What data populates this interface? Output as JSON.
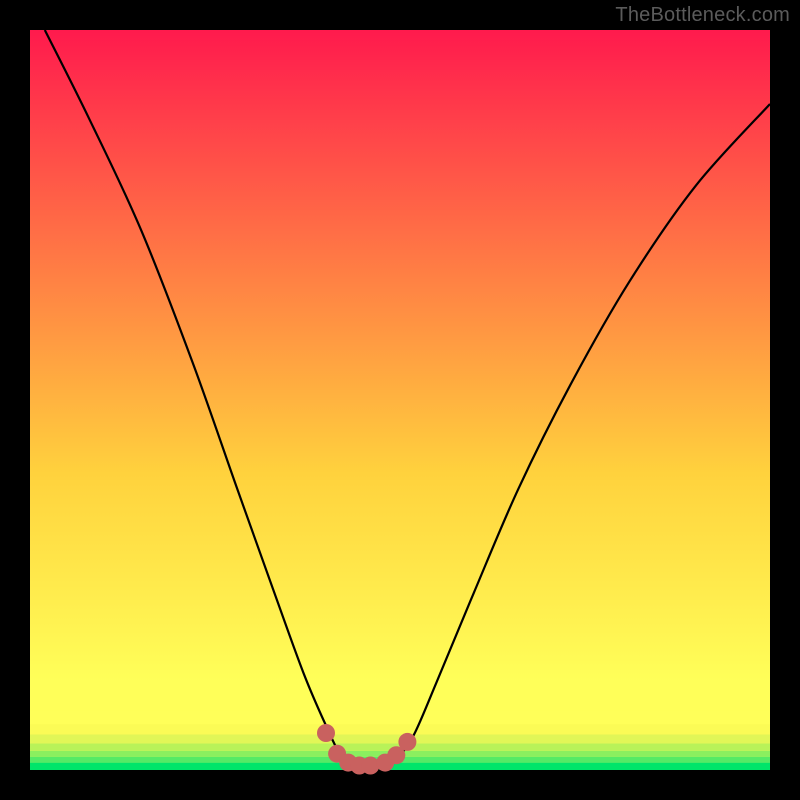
{
  "attribution": "TheBottleneck.com",
  "chart_data": {
    "type": "line",
    "title": "",
    "xlabel": "",
    "ylabel": "",
    "xlim": [
      0,
      100
    ],
    "ylim": [
      0,
      100
    ],
    "series": [
      {
        "name": "bottleneck-curve",
        "x": [
          2,
          8,
          15,
          22,
          28,
          33,
          37,
          40,
          42,
          44,
          46,
          48,
          50,
          52,
          55,
          60,
          66,
          73,
          81,
          90,
          100
        ],
        "y": [
          100,
          88,
          73,
          55,
          38,
          24,
          13,
          6,
          2,
          0.5,
          0,
          0.5,
          2,
          5,
          12,
          24,
          38,
          52,
          66,
          79,
          90
        ]
      }
    ],
    "markers": {
      "name": "optimum-markers",
      "x": [
        40.0,
        41.5,
        43.0,
        44.5,
        46.0,
        48.0,
        49.5,
        51.0
      ],
      "y": [
        5,
        2.2,
        1.0,
        0.6,
        0.6,
        1.0,
        2.0,
        3.8
      ]
    },
    "bands": [
      {
        "ymin": 0,
        "ymax": 1.0,
        "color": "#00e56a"
      },
      {
        "ymin": 1.0,
        "ymax": 1.8,
        "color": "#55ea66"
      },
      {
        "ymin": 1.8,
        "ymax": 2.6,
        "color": "#8bef5f"
      },
      {
        "ymin": 2.6,
        "ymax": 3.6,
        "color": "#b8f259"
      },
      {
        "ymin": 3.6,
        "ymax": 4.8,
        "color": "#e1f657"
      },
      {
        "ymin": 4.8,
        "ymax": 6.2,
        "color": "#fbfb56"
      },
      {
        "ymin": 6.2,
        "ymax": 8.0,
        "color": "#ffff59"
      }
    ],
    "gradient_top": "#ff1a4d",
    "gradient_mid": "#ffd23d",
    "gradient_band_top": "#ffff59"
  }
}
